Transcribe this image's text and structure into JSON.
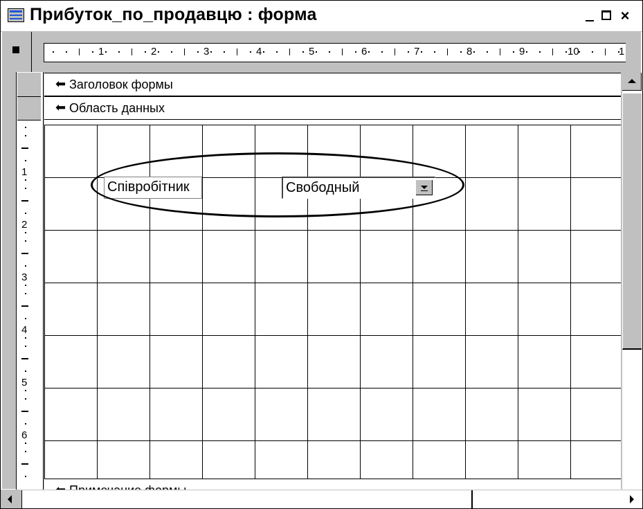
{
  "window": {
    "title": "Прибуток_по_продавцю : форма",
    "minimize_glyph": "_",
    "close_glyph": "×"
  },
  "ruler": {
    "horizontal_numbers": [
      "1",
      "2",
      "3",
      "4",
      "5",
      "6",
      "7",
      "8",
      "9",
      "10",
      "1"
    ],
    "vertical_numbers": [
      "1",
      "2",
      "3",
      "4",
      "5",
      "6"
    ]
  },
  "sections": {
    "header_label": "Заголовок формы",
    "detail_label": "Область данных",
    "footer_label": "Примечание формы",
    "section_glyph": "⬅"
  },
  "controls": {
    "label_text": "Співробітник",
    "combo_text": "Свободный"
  }
}
